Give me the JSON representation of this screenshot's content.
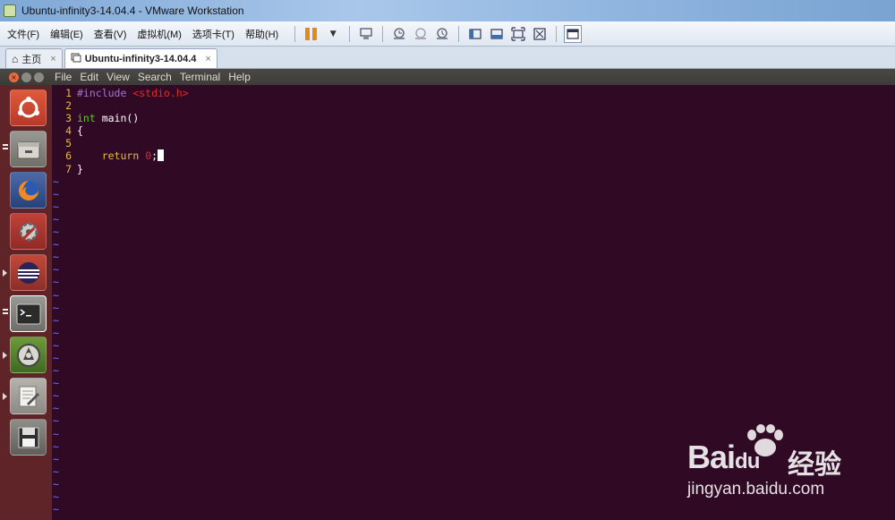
{
  "window": {
    "title": "Ubuntu-infinity3-14.04.4 - VMware Workstation"
  },
  "menu": {
    "items": [
      "文件(F)",
      "编辑(E)",
      "查看(V)",
      "虚拟机(M)",
      "选项卡(T)",
      "帮助(H)"
    ]
  },
  "toolbar": {
    "icons": [
      "pause-icon",
      "dropdown-icon",
      "send-ctrl-alt-del-icon",
      "snapshot-icon",
      "revert-snapshot-icon",
      "snapshot-manager-icon",
      "sidebar-icon",
      "thumbnail-bar-icon",
      "fullscreen-icon",
      "unity-icon",
      "console-view-icon"
    ]
  },
  "tabs": [
    {
      "label": "主页",
      "icon": "home-icon"
    },
    {
      "label": "Ubuntu-infinity3-14.04.4",
      "icon": "vm-icon",
      "active": true
    }
  ],
  "terminal": {
    "menu": [
      "File",
      "Edit",
      "View",
      "Search",
      "Terminal",
      "Help"
    ],
    "code": [
      {
        "n": "1",
        "pre": "#include ",
        "str": "<stdio.h>"
      },
      {
        "n": "2"
      },
      {
        "n": "3",
        "kw": "int",
        "rest": " main()"
      },
      {
        "n": "4",
        "rest": "{"
      },
      {
        "n": "5"
      },
      {
        "n": "6",
        "indent": "    ",
        "rk": "return",
        "sp": " ",
        "num": "0",
        "tail": ";"
      },
      {
        "n": "7",
        "rest": "}"
      }
    ],
    "tilde": "~",
    "tilde_count": 27
  },
  "launcher": {
    "items": [
      "ubuntu-dash-icon",
      "files-icon",
      "firefox-icon",
      "system-settings-icon",
      "eclipse-icon",
      "terminal-icon",
      "software-updater-icon",
      "text-editor-icon",
      "save-disk-icon"
    ]
  },
  "watermark": {
    "brand": "Bai",
    "brand2": "du",
    "cn": "经验",
    "url": "jingyan.baidu.com"
  },
  "colors": {
    "terminal_bg": "#300a24",
    "launcher_bg": "#5e2427",
    "line_number": "#e5b84c",
    "tilde": "#6f6fff"
  }
}
